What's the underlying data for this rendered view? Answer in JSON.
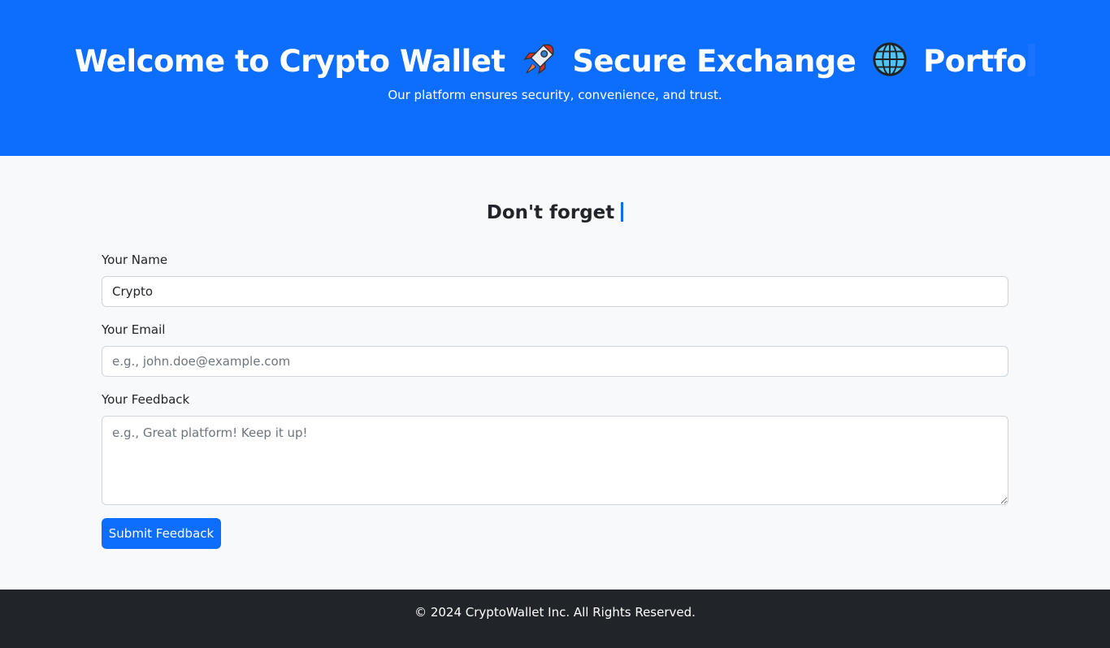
{
  "hero": {
    "title_part1": "Welcome to Crypto Wallet",
    "emoji1": "rocket-icon",
    "title_part2": "Secure Exchange",
    "emoji2": "globe-icon",
    "title_part3": "Portfo",
    "subtitle": "Our platform ensures security, convenience, and trust."
  },
  "feedback": {
    "heading": "Don't forget",
    "name_label": "Your Name",
    "name_value": "Crypto",
    "email_label": "Your Email",
    "email_placeholder": "e.g., john.doe@example.com",
    "feedback_label": "Your Feedback",
    "feedback_placeholder": "e.g., Great platform! Keep it up!",
    "submit_label": "Submit Feedback"
  },
  "footer": {
    "copyright": "© 2024 CryptoWallet Inc. All Rights Reserved."
  },
  "colors": {
    "primary": "#0d6efd",
    "footer_bg": "#212529",
    "page_bg": "#f8f9fa"
  }
}
